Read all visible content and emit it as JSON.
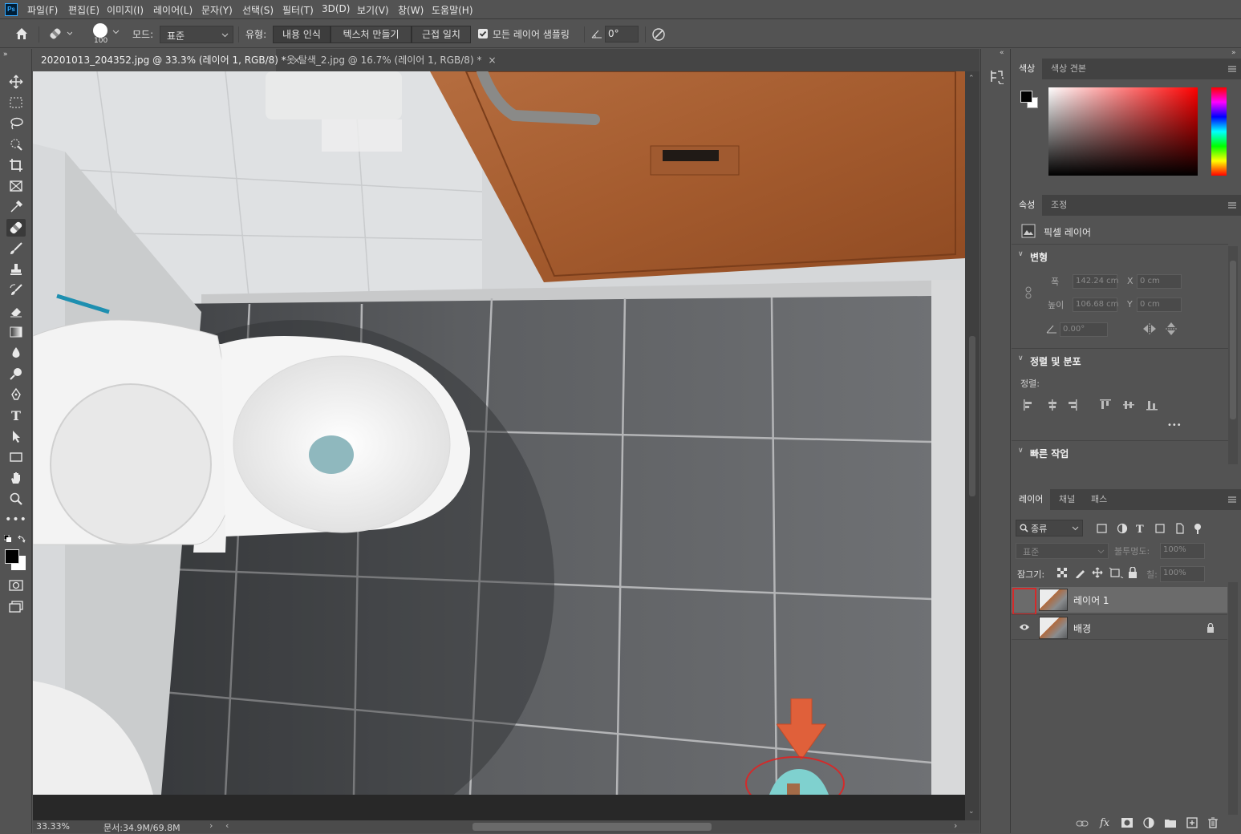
{
  "app": {
    "logo": "Ps"
  },
  "menu": [
    "파일(F)",
    "편집(E)",
    "이미지(I)",
    "레이어(L)",
    "문자(Y)",
    "선택(S)",
    "필터(T)",
    "3D(D)",
    "보기(V)",
    "창(W)",
    "도움말(H)"
  ],
  "options": {
    "brush_size": "100",
    "mode_label": "모드:",
    "mode_value": "표준",
    "type_label": "유형:",
    "type_buttons": [
      "내용 인식",
      "텍스처 만들기",
      "근접 일치"
    ],
    "sample_all_label": "모든 레이어 샘플링",
    "angle_value": "0°"
  },
  "tabs": [
    {
      "label": "20201013_204352.jpg @ 33.3% (레이어 1, RGB/8) *",
      "close": "×"
    },
    {
      "label": "옷 탈색_2.jpg @ 16.7% (레이어 1, RGB/8) *",
      "close": "×"
    }
  ],
  "status": {
    "zoom": "33.33%",
    "doc": "문서:34.9M/69.8M"
  },
  "color_panel": {
    "tabs": [
      "색상",
      "색상 견본"
    ]
  },
  "properties_panel": {
    "tabs": [
      "속성",
      "조정"
    ],
    "layer_type": "픽셀 레이어",
    "transform_title": "변형",
    "width_label": "폭",
    "width_value": "142.24 cm",
    "height_label": "높이",
    "height_value": "106.68 cm",
    "x_label": "X",
    "x_value": "0 cm",
    "y_label": "Y",
    "y_value": "0 cm",
    "angle_value": "0.00°",
    "align_title": "정렬 및 분포",
    "align_label": "정렬:",
    "more": "•••",
    "quick_title": "빠른 작업"
  },
  "layers_panel": {
    "tabs": [
      "레이어",
      "채널",
      "패스"
    ],
    "filter_value": "종류",
    "blend_value": "표준",
    "opacity_label": "불투명도:",
    "opacity_value": "100%",
    "lock_label": "잠그기:",
    "fill_label": "칠:",
    "fill_value": "100%",
    "layers": [
      {
        "name": "레이어 1",
        "visible": false,
        "selected": true,
        "locked": false
      },
      {
        "name": "배경",
        "visible": true,
        "selected": false,
        "locked": true
      }
    ]
  },
  "colors": {
    "annotation": "#e0603a",
    "highlight_box": "#d42a2a"
  }
}
